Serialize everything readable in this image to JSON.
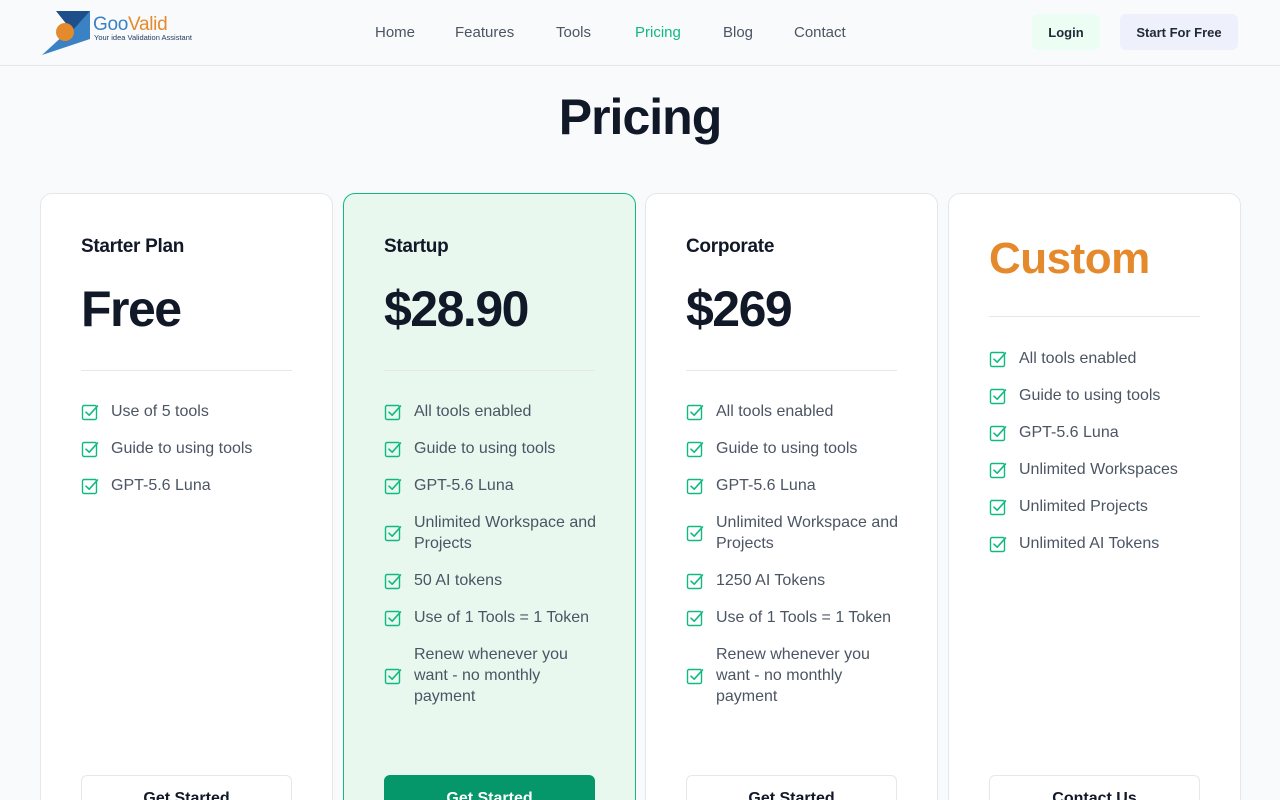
{
  "brand": {
    "name_part1": "Goo",
    "name_part2": "Valid",
    "tagline": "Your idea Validation Assistant",
    "colors": {
      "accent": "#10b981",
      "orange": "#e58a2c",
      "blue": "#3b82c4"
    }
  },
  "nav": {
    "items": [
      {
        "label": "Home"
      },
      {
        "label": "Features"
      },
      {
        "label": "Tools"
      },
      {
        "label": "Pricing",
        "active": true
      },
      {
        "label": "Blog"
      },
      {
        "label": "Contact"
      }
    ],
    "login": "Login",
    "start": "Start For Free"
  },
  "page": {
    "title": "Pricing"
  },
  "plans": [
    {
      "name": "Starter Plan",
      "price": "Free",
      "features": [
        "Use of 5 tools",
        "Guide to using tools",
        "GPT-5.6 Luna"
      ],
      "button": "Get Started"
    },
    {
      "name": "Startup",
      "price": "$28.90",
      "features": [
        "All tools enabled",
        "Guide to using tools",
        "GPT-5.6 Luna",
        "Unlimited Workspace and Projects",
        "50 AI tokens",
        "Use of 1 Tools = 1 Token",
        "Renew whenever you want - no monthly payment"
      ],
      "button": "Get Started"
    },
    {
      "name": "Corporate",
      "price": "$269",
      "features": [
        "All tools enabled",
        "Guide to using tools",
        "GPT-5.6 Luna",
        "Unlimited Workspace and Projects",
        "1250 AI Tokens",
        "Use of 1 Tools = 1 Token",
        "Renew whenever you want - no monthly payment"
      ],
      "button": "Get Started"
    },
    {
      "name": "",
      "price": "Custom",
      "features": [
        "All tools enabled",
        "Guide to using tools",
        "GPT-5.6 Luna",
        "Unlimited Workspaces",
        "Unlimited Projects",
        "Unlimited AI Tokens"
      ],
      "button": "Contact Us"
    }
  ]
}
